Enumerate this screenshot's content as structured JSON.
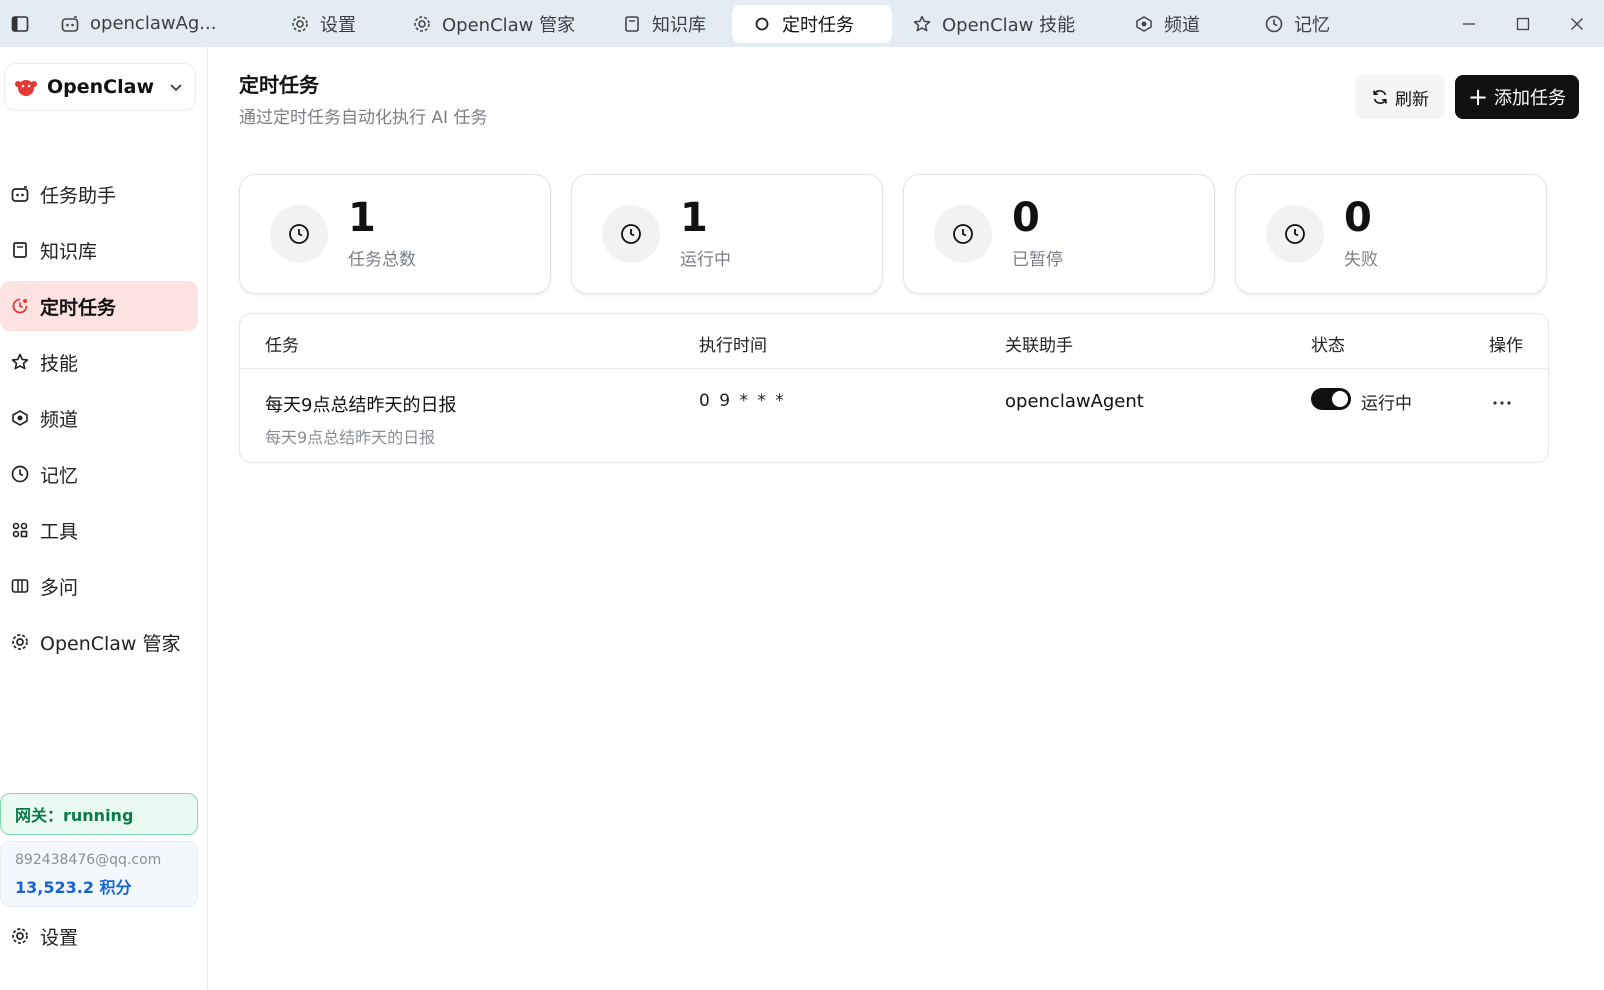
{
  "tabs": [
    {
      "label": "openclawAg...",
      "icon": "bot-icon"
    },
    {
      "label": "设置",
      "icon": "gear-icon"
    },
    {
      "label": "OpenClaw 管家",
      "icon": "gear-icon"
    },
    {
      "label": "知识库",
      "icon": "book-icon"
    },
    {
      "label": "定时任务",
      "icon": "circle-icon",
      "active": true
    },
    {
      "label": "OpenClaw 技能",
      "icon": "star-icon"
    },
    {
      "label": "频道",
      "icon": "channel-icon"
    },
    {
      "label": "记忆",
      "icon": "clock-icon"
    }
  ],
  "sidebar": {
    "brand": "OpenClaw",
    "items": [
      {
        "label": "任务助手",
        "icon": "bot-icon"
      },
      {
        "label": "知识库",
        "icon": "book-icon"
      },
      {
        "label": "定时任务",
        "icon": "scheduled-icon",
        "active": true
      },
      {
        "label": "技能",
        "icon": "star-icon"
      },
      {
        "label": "频道",
        "icon": "channel-icon"
      },
      {
        "label": "记忆",
        "icon": "clock-icon"
      },
      {
        "label": "工具",
        "icon": "tools-icon"
      },
      {
        "label": "多问",
        "icon": "columns-icon"
      },
      {
        "label": "OpenClaw 管家",
        "icon": "gear-icon"
      }
    ],
    "gateway": "网关：running",
    "account_email": "892438476@qq.com",
    "account_points": "13,523.2 积分",
    "settings": "设置"
  },
  "main": {
    "title": "定时任务",
    "subtitle": "通过定时任务自动化执行 AI 任务",
    "refresh_label": "刷新",
    "add_label": "添加任务",
    "add_plus": "+"
  },
  "stats": [
    {
      "value": "1",
      "label": "任务总数"
    },
    {
      "value": "1",
      "label": "运行中"
    },
    {
      "value": "0",
      "label": "已暂停"
    },
    {
      "value": "0",
      "label": "失败"
    }
  ],
  "table": {
    "headers": {
      "task": "任务",
      "time": "执行时间",
      "agent": "关联助手",
      "status": "状态",
      "actions": "操作"
    },
    "rows": [
      {
        "name": "每天9点总结昨天的日报",
        "desc": "每天9点总结昨天的日报",
        "cron": "0 9 * * *",
        "agent": "openclawAgent",
        "enabled": true,
        "status": "运行中"
      }
    ]
  },
  "colors": {
    "accent_active_bg": "#fde2e2",
    "gateway_green": "#0b7a4b",
    "points_blue": "#1565d8",
    "primary_button": "#111111"
  }
}
